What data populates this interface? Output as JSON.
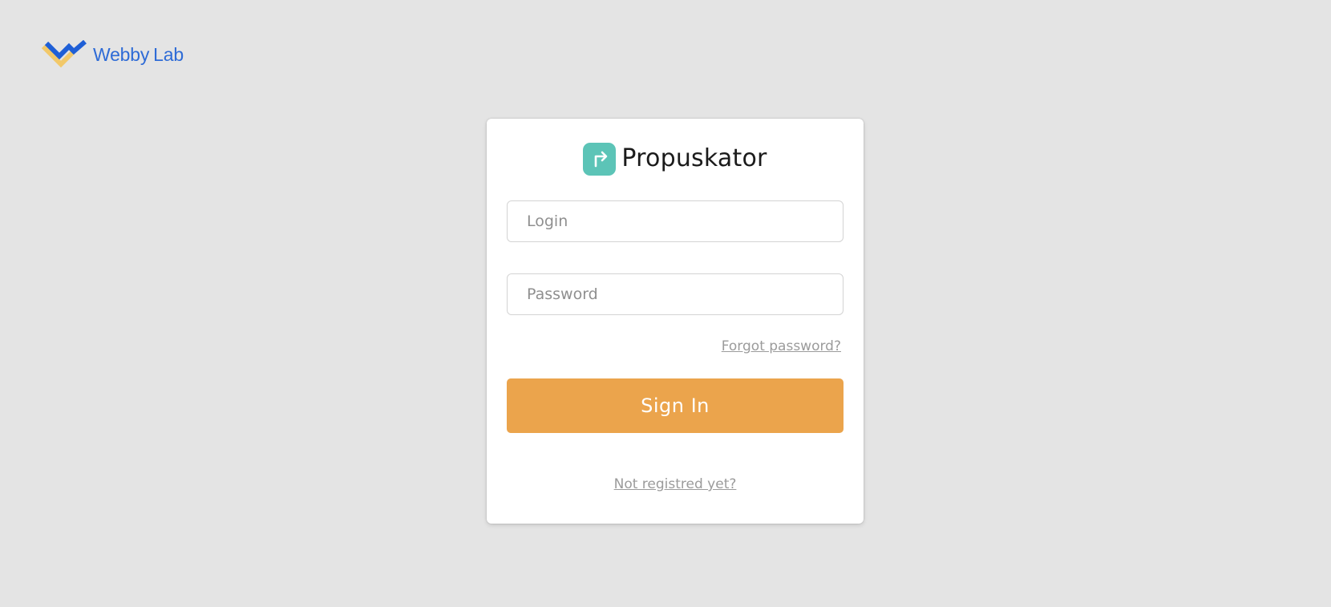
{
  "brand": {
    "name_part1": "Webby",
    "name_part2": "Lab",
    "logo_icon": "webbylab-check-logo-icon",
    "colors": {
      "text": "#2e6bd6",
      "mark_blue": "#1f5fd6",
      "mark_yellow": "#f2c869"
    }
  },
  "app": {
    "name": "Propuskator",
    "icon": "exit-arrow-icon",
    "icon_color": "#5cc4b7"
  },
  "form": {
    "login_placeholder": "Login",
    "login_value": "",
    "password_placeholder": "Password",
    "password_value": "",
    "forgot_label": "Forgot password?",
    "submit_label": "Sign In",
    "submit_color": "#eba44c",
    "register_label": "Not registred yet?"
  },
  "colors": {
    "background": "#e4e4e4",
    "card": "#ffffff",
    "link": "#9b9b9b"
  }
}
